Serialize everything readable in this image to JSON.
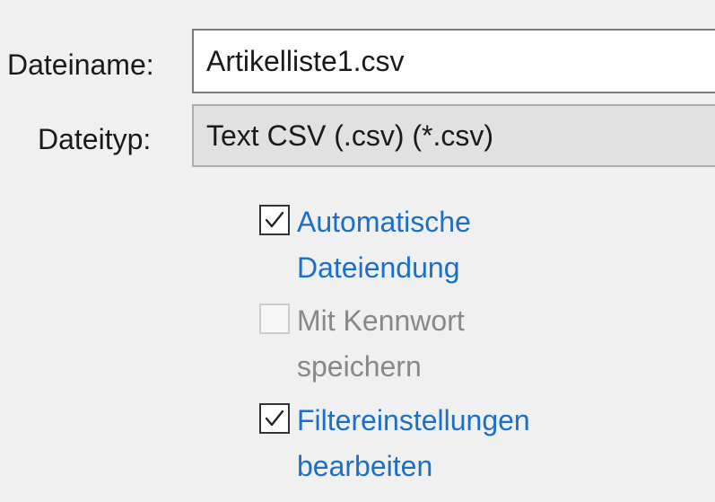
{
  "file_dialog": {
    "filename_label": "Dateiname:",
    "filename_value": "Artikelliste1.csv",
    "filetype_label": "Dateityp:",
    "filetype_value": "Text CSV (.csv) (*.csv)"
  },
  "options": [
    {
      "line1": "Automatische",
      "line2": "Dateiendung",
      "checked": true,
      "enabled": true
    },
    {
      "line1": "Mit Kennwort",
      "line2": "speichern",
      "checked": false,
      "enabled": false
    },
    {
      "line1": "Filtereinstellungen",
      "line2": "bearbeiten",
      "checked": true,
      "enabled": true
    }
  ],
  "colors": {
    "background": "#f0f0f0",
    "link_text": "#1a6fc9",
    "disabled_text": "#888888"
  },
  "icons": {
    "checked": "checkmark-icon"
  }
}
